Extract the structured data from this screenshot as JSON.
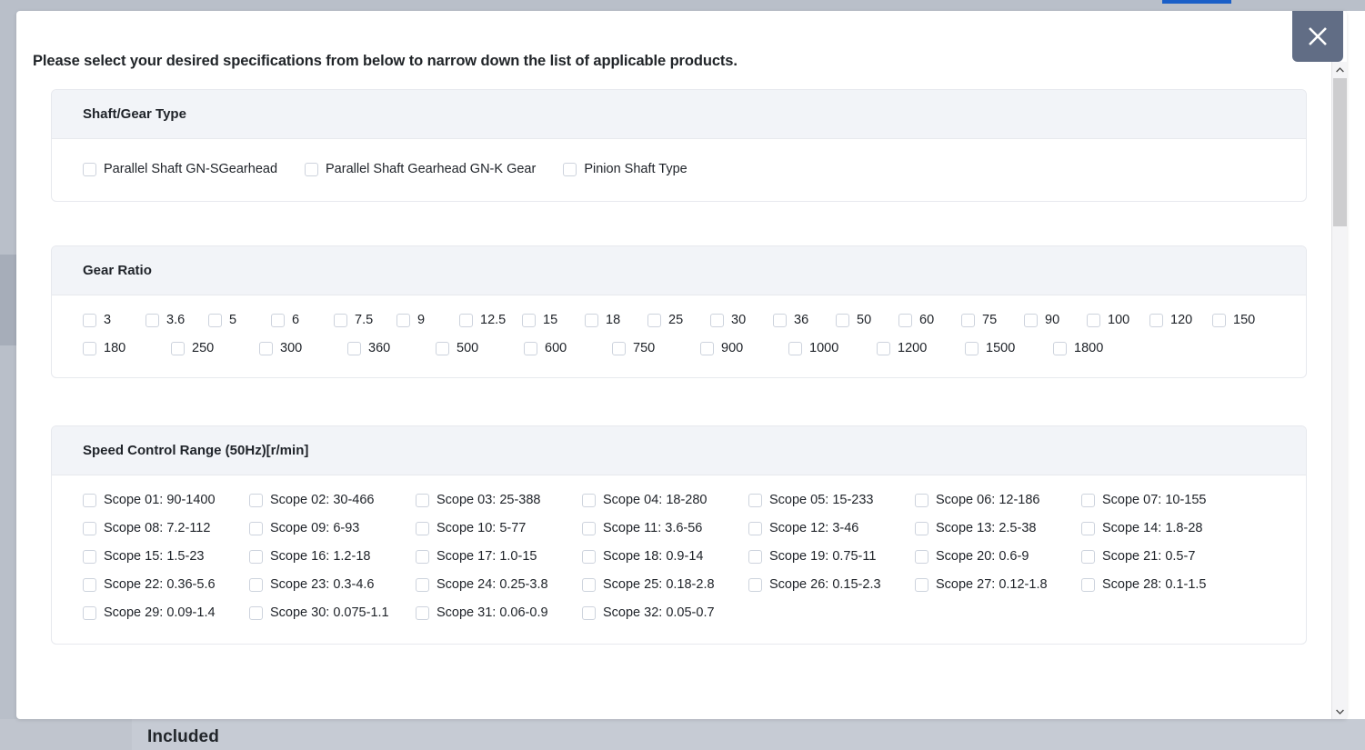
{
  "background": {
    "bottom_label": "Included"
  },
  "modal": {
    "title": "Please select your desired specifications from below to narrow down the list of applicable products.",
    "close_icon": "close-icon",
    "close_label": "Close",
    "scrollbar": {
      "up_arrow": "⌃",
      "down_arrow": "⌄"
    }
  },
  "sections": [
    {
      "id": "shaft-gear-type",
      "title": "Shaft/Gear Type",
      "rows": [
        [
          "Parallel Shaft GN-SGearhead",
          "Parallel Shaft Gearhead GN-K Gear",
          "Pinion Shaft Type"
        ]
      ]
    },
    {
      "id": "gear-ratio",
      "title": "Gear Ratio",
      "rows": [
        [
          "3",
          "3.6",
          "5",
          "6",
          "7.5",
          "9",
          "12.5",
          "15",
          "18",
          "25",
          "30",
          "36",
          "50",
          "60",
          "75",
          "90",
          "100",
          "120",
          "150"
        ],
        [
          "180",
          "250",
          "300",
          "360",
          "500",
          "600",
          "750",
          "900",
          "1000",
          "1200",
          "1500",
          "1800"
        ]
      ]
    },
    {
      "id": "speed-control-range",
      "title": "Speed Control Range (50Hz)[r/min]",
      "rows": [
        [
          "Scope 01: 90-1400",
          "Scope 02: 30-466",
          "Scope 03: 25-388",
          "Scope 04: 18-280",
          "Scope 05: 15-233",
          "Scope 06: 12-186",
          "Scope 07: 10-155"
        ],
        [
          "Scope 08: 7.2-112",
          "Scope 09: 6-93",
          "Scope 10: 5-77",
          "Scope 11: 3.6-56",
          "Scope 12: 3-46",
          "Scope 13: 2.5-38",
          "Scope 14: 1.8-28"
        ],
        [
          "Scope 15: 1.5-23",
          "Scope 16: 1.2-18",
          "Scope 17: 1.0-15",
          "Scope 18: 0.9-14",
          "Scope 19: 0.75-11",
          "Scope 20: 0.6-9",
          "Scope 21: 0.5-7"
        ],
        [
          "Scope 22: 0.36-5.6",
          "Scope 23: 0.3-4.6",
          "Scope 24: 0.25-3.8",
          "Scope 25: 0.18-2.8",
          "Scope 26: 0.15-2.3",
          "Scope 27: 0.12-1.8",
          "Scope 28: 0.1-1.5"
        ],
        [
          "Scope 29: 0.09-1.4",
          "Scope 30: 0.075-1.1",
          "Scope 31: 0.06-0.9",
          "Scope 32: 0.05-0.7"
        ]
      ]
    }
  ],
  "colors": {
    "header_bg": "#f2f4f8",
    "card_border": "#e7e9ee",
    "close_bg": "#616d85",
    "text": "#20242a",
    "page_chrome": "#b9bfc9",
    "accent_blue": "#1a5fc8"
  }
}
